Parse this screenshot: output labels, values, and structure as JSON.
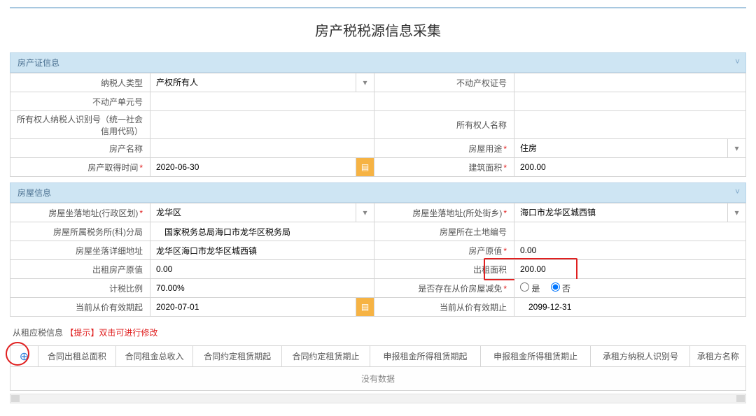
{
  "page_title": "房产税税源信息采集",
  "section1": {
    "header": "房产证信息",
    "labels": {
      "taxpayer_type": "纳税人类型",
      "cert_no": "不动产权证号",
      "unit_no": "不动产单元号",
      "owner_id": "所有权人纳税人识别号（统一社会信用代码）",
      "owner_name": "所有权人名称",
      "property_name": "房产名称",
      "usage": "房屋用途",
      "acquire_date": "房产取得时间",
      "area": "建筑面积"
    },
    "values": {
      "taxpayer_type": "产权所有人",
      "cert_no": "",
      "unit_no": "",
      "owner_id": "",
      "owner_name": "",
      "property_name": "",
      "usage": "住房",
      "acquire_date": "2020-06-30",
      "area": "200.00"
    }
  },
  "section2": {
    "header": "房屋信息",
    "labels": {
      "location_admin": "房屋坐落地址(行政区划)",
      "location_street": "房屋坐落地址(所处街乡)",
      "tax_bureau": "房屋所属税务所(科)分局",
      "land_no": "房屋所在土地编号",
      "detail_addr": "房屋坐落详细地址",
      "orig_value": "房产原值",
      "rent_orig_value": "出租房产原值",
      "rent_area": "出租面积",
      "tax_ratio": "计税比例",
      "has_reduction": "是否存在从价房屋减免",
      "valid_from": "当前从价有效期起",
      "valid_to": "当前从价有效期止"
    },
    "values": {
      "location_admin": "龙华区",
      "location_street": "海口市龙华区城西镇",
      "tax_bureau": "国家税务总局海口市龙华区税务局",
      "land_no": "",
      "detail_addr": "龙华区海口市龙华区城西镇",
      "orig_value": "0.00",
      "rent_orig_value": "0.00",
      "rent_area": "200.00",
      "tax_ratio": "70.00%",
      "reduction_yes": "是",
      "reduction_no": "否",
      "valid_from": "2020-07-01",
      "valid_to": "2099-12-31"
    }
  },
  "section3": {
    "header": "从租应税信息",
    "hint": "【提示】双击可进行修改",
    "columns": {
      "total_area": "合同出租总面积",
      "total_income": "合同租金总收入",
      "agreed_from": "合同约定租赁期起",
      "agreed_to": "合同约定租赁期止",
      "declare_from": "申报租金所得租赁期起",
      "declare_to": "申报租金所得租赁期止",
      "tenant_id": "承租方纳税人识别号",
      "tenant_name": "承租方名称"
    },
    "no_data": "没有数据"
  },
  "icons": {
    "chevron": "˅",
    "select_arrow": "▾",
    "calendar": "▤",
    "plus": "⊕"
  }
}
